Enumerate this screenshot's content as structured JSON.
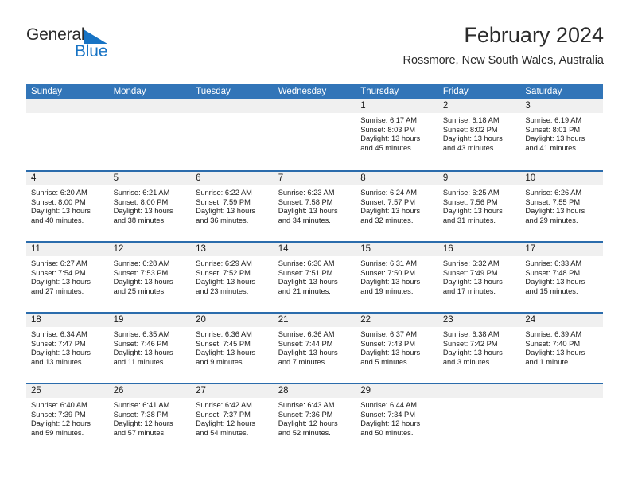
{
  "brand": {
    "name_top": "General",
    "name_bottom": "Blue",
    "flag_icon": "triangle-flag-icon",
    "top_color": "#2b2b2b",
    "bottom_color": "#1773c4"
  },
  "header": {
    "month_title": "February 2024",
    "location": "Rossmore, New South Wales, Australia"
  },
  "theme": {
    "header_blue": "#3275b8",
    "row_divider_blue": "#2b6cac",
    "day_band_gray": "#f0f0f0",
    "text_dark": "#1a1a1a"
  },
  "calendar": {
    "weekdays": [
      "Sunday",
      "Monday",
      "Tuesday",
      "Wednesday",
      "Thursday",
      "Friday",
      "Saturday"
    ],
    "weeks": [
      [
        {
          "day": "",
          "sunrise": "",
          "sunset": "",
          "daylight": "",
          "empty": true
        },
        {
          "day": "",
          "sunrise": "",
          "sunset": "",
          "daylight": "",
          "empty": true
        },
        {
          "day": "",
          "sunrise": "",
          "sunset": "",
          "daylight": "",
          "empty": true
        },
        {
          "day": "",
          "sunrise": "",
          "sunset": "",
          "daylight": "",
          "empty": true
        },
        {
          "day": "1",
          "sunrise": "Sunrise: 6:17 AM",
          "sunset": "Sunset: 8:03 PM",
          "daylight": "Daylight: 13 hours and 45 minutes.",
          "empty": false
        },
        {
          "day": "2",
          "sunrise": "Sunrise: 6:18 AM",
          "sunset": "Sunset: 8:02 PM",
          "daylight": "Daylight: 13 hours and 43 minutes.",
          "empty": false
        },
        {
          "day": "3",
          "sunrise": "Sunrise: 6:19 AM",
          "sunset": "Sunset: 8:01 PM",
          "daylight": "Daylight: 13 hours and 41 minutes.",
          "empty": false
        }
      ],
      [
        {
          "day": "4",
          "sunrise": "Sunrise: 6:20 AM",
          "sunset": "Sunset: 8:00 PM",
          "daylight": "Daylight: 13 hours and 40 minutes.",
          "empty": false
        },
        {
          "day": "5",
          "sunrise": "Sunrise: 6:21 AM",
          "sunset": "Sunset: 8:00 PM",
          "daylight": "Daylight: 13 hours and 38 minutes.",
          "empty": false
        },
        {
          "day": "6",
          "sunrise": "Sunrise: 6:22 AM",
          "sunset": "Sunset: 7:59 PM",
          "daylight": "Daylight: 13 hours and 36 minutes.",
          "empty": false
        },
        {
          "day": "7",
          "sunrise": "Sunrise: 6:23 AM",
          "sunset": "Sunset: 7:58 PM",
          "daylight": "Daylight: 13 hours and 34 minutes.",
          "empty": false
        },
        {
          "day": "8",
          "sunrise": "Sunrise: 6:24 AM",
          "sunset": "Sunset: 7:57 PM",
          "daylight": "Daylight: 13 hours and 32 minutes.",
          "empty": false
        },
        {
          "day": "9",
          "sunrise": "Sunrise: 6:25 AM",
          "sunset": "Sunset: 7:56 PM",
          "daylight": "Daylight: 13 hours and 31 minutes.",
          "empty": false
        },
        {
          "day": "10",
          "sunrise": "Sunrise: 6:26 AM",
          "sunset": "Sunset: 7:55 PM",
          "daylight": "Daylight: 13 hours and 29 minutes.",
          "empty": false
        }
      ],
      [
        {
          "day": "11",
          "sunrise": "Sunrise: 6:27 AM",
          "sunset": "Sunset: 7:54 PM",
          "daylight": "Daylight: 13 hours and 27 minutes.",
          "empty": false
        },
        {
          "day": "12",
          "sunrise": "Sunrise: 6:28 AM",
          "sunset": "Sunset: 7:53 PM",
          "daylight": "Daylight: 13 hours and 25 minutes.",
          "empty": false
        },
        {
          "day": "13",
          "sunrise": "Sunrise: 6:29 AM",
          "sunset": "Sunset: 7:52 PM",
          "daylight": "Daylight: 13 hours and 23 minutes.",
          "empty": false
        },
        {
          "day": "14",
          "sunrise": "Sunrise: 6:30 AM",
          "sunset": "Sunset: 7:51 PM",
          "daylight": "Daylight: 13 hours and 21 minutes.",
          "empty": false
        },
        {
          "day": "15",
          "sunrise": "Sunrise: 6:31 AM",
          "sunset": "Sunset: 7:50 PM",
          "daylight": "Daylight: 13 hours and 19 minutes.",
          "empty": false
        },
        {
          "day": "16",
          "sunrise": "Sunrise: 6:32 AM",
          "sunset": "Sunset: 7:49 PM",
          "daylight": "Daylight: 13 hours and 17 minutes.",
          "empty": false
        },
        {
          "day": "17",
          "sunrise": "Sunrise: 6:33 AM",
          "sunset": "Sunset: 7:48 PM",
          "daylight": "Daylight: 13 hours and 15 minutes.",
          "empty": false
        }
      ],
      [
        {
          "day": "18",
          "sunrise": "Sunrise: 6:34 AM",
          "sunset": "Sunset: 7:47 PM",
          "daylight": "Daylight: 13 hours and 13 minutes.",
          "empty": false
        },
        {
          "day": "19",
          "sunrise": "Sunrise: 6:35 AM",
          "sunset": "Sunset: 7:46 PM",
          "daylight": "Daylight: 13 hours and 11 minutes.",
          "empty": false
        },
        {
          "day": "20",
          "sunrise": "Sunrise: 6:36 AM",
          "sunset": "Sunset: 7:45 PM",
          "daylight": "Daylight: 13 hours and 9 minutes.",
          "empty": false
        },
        {
          "day": "21",
          "sunrise": "Sunrise: 6:36 AM",
          "sunset": "Sunset: 7:44 PM",
          "daylight": "Daylight: 13 hours and 7 minutes.",
          "empty": false
        },
        {
          "day": "22",
          "sunrise": "Sunrise: 6:37 AM",
          "sunset": "Sunset: 7:43 PM",
          "daylight": "Daylight: 13 hours and 5 minutes.",
          "empty": false
        },
        {
          "day": "23",
          "sunrise": "Sunrise: 6:38 AM",
          "sunset": "Sunset: 7:42 PM",
          "daylight": "Daylight: 13 hours and 3 minutes.",
          "empty": false
        },
        {
          "day": "24",
          "sunrise": "Sunrise: 6:39 AM",
          "sunset": "Sunset: 7:40 PM",
          "daylight": "Daylight: 13 hours and 1 minute.",
          "empty": false
        }
      ],
      [
        {
          "day": "25",
          "sunrise": "Sunrise: 6:40 AM",
          "sunset": "Sunset: 7:39 PM",
          "daylight": "Daylight: 12 hours and 59 minutes.",
          "empty": false
        },
        {
          "day": "26",
          "sunrise": "Sunrise: 6:41 AM",
          "sunset": "Sunset: 7:38 PM",
          "daylight": "Daylight: 12 hours and 57 minutes.",
          "empty": false
        },
        {
          "day": "27",
          "sunrise": "Sunrise: 6:42 AM",
          "sunset": "Sunset: 7:37 PM",
          "daylight": "Daylight: 12 hours and 54 minutes.",
          "empty": false
        },
        {
          "day": "28",
          "sunrise": "Sunrise: 6:43 AM",
          "sunset": "Sunset: 7:36 PM",
          "daylight": "Daylight: 12 hours and 52 minutes.",
          "empty": false
        },
        {
          "day": "29",
          "sunrise": "Sunrise: 6:44 AM",
          "sunset": "Sunset: 7:34 PM",
          "daylight": "Daylight: 12 hours and 50 minutes.",
          "empty": false
        },
        {
          "day": "",
          "sunrise": "",
          "sunset": "",
          "daylight": "",
          "empty": true
        },
        {
          "day": "",
          "sunrise": "",
          "sunset": "",
          "daylight": "",
          "empty": true
        }
      ]
    ]
  }
}
